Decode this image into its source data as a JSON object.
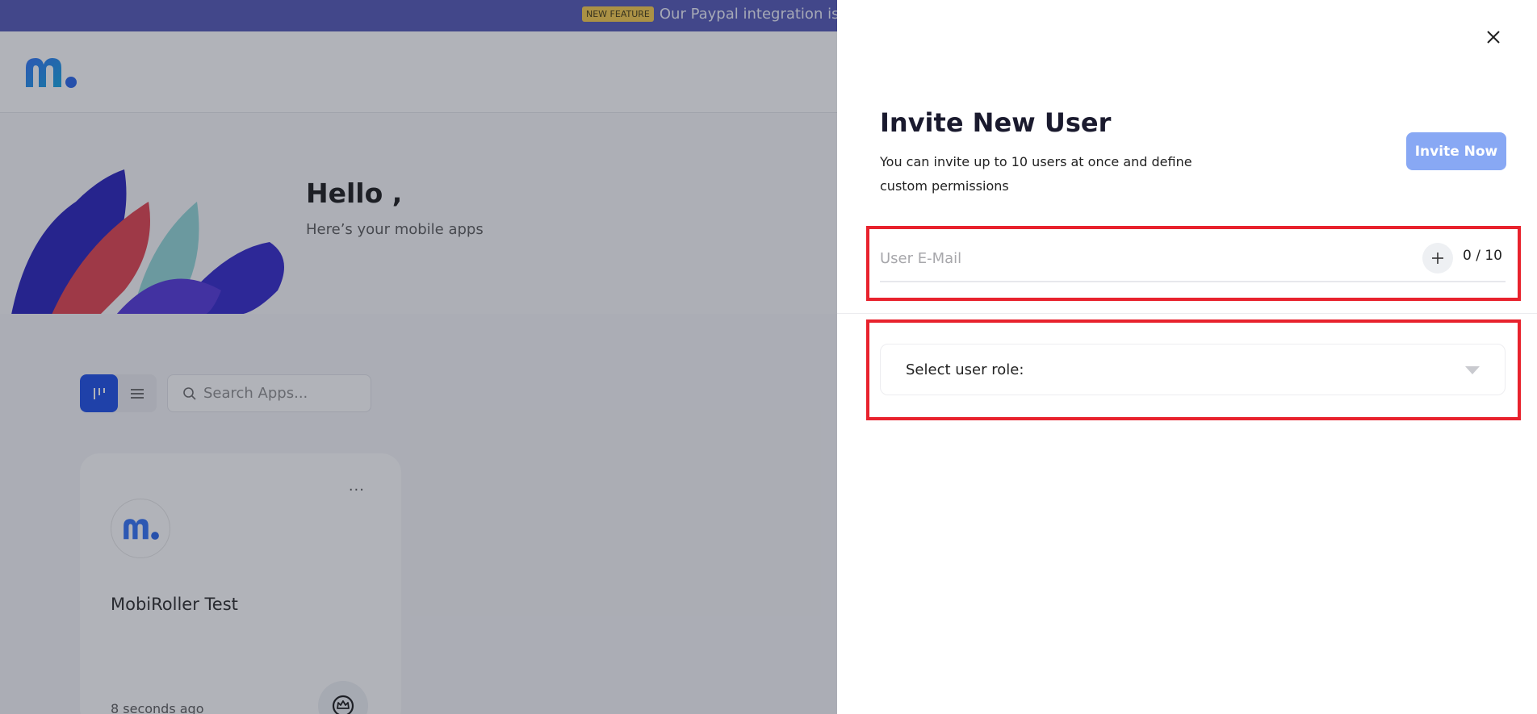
{
  "announcement": {
    "badge": "NEW FEATURE",
    "text": "Our Paypal integration is"
  },
  "hero": {
    "greeting": "Hello ,",
    "subtitle": "Here’s your mobile apps"
  },
  "toolbar": {
    "search_placeholder": "Search Apps..."
  },
  "app_card": {
    "name": "MobiRoller Test",
    "time": "8 seconds ago",
    "menu": "..."
  },
  "drawer": {
    "title": "Invite New User",
    "description": "You can invite up to 10 users at once and define custom permissions",
    "invite_button": "Invite Now",
    "email_placeholder": "User E-Mail",
    "counter": "0 / 10",
    "role_label": "Select user role:"
  },
  "colors": {
    "brand": "#1447e6",
    "announce_bg": "#4c52b3",
    "invite_button": "#88a8f4",
    "highlight": "#e8222d"
  }
}
